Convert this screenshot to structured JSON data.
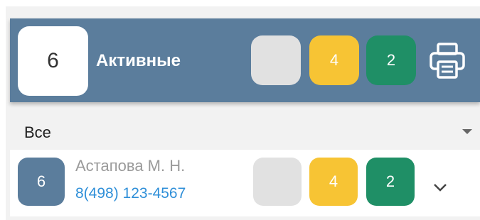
{
  "header": {
    "count": "6",
    "title": "Активные",
    "badges": [
      {
        "status": "neutral",
        "value": "",
        "color": "#e1e1e1"
      },
      {
        "status": "warning",
        "value": "4",
        "color": "#f7c434"
      },
      {
        "status": "success",
        "value": "2",
        "color": "#1f8f66"
      }
    ],
    "print_icon": "printer-icon",
    "background_color": "#5b7d9c"
  },
  "filter": {
    "selected": "Все",
    "icon": "caret-down-icon"
  },
  "rows": [
    {
      "count": "6",
      "name": "Астапова М. Н.",
      "phone": "8(498) 123-4567",
      "badges": [
        {
          "status": "neutral",
          "value": ""
        },
        {
          "status": "warning",
          "value": "4"
        },
        {
          "status": "success",
          "value": "2"
        }
      ],
      "expand_icon": "chevron-down-icon"
    }
  ],
  "colors": {
    "link": "#2f8fd8",
    "muted_text": "#9a9a9a"
  }
}
